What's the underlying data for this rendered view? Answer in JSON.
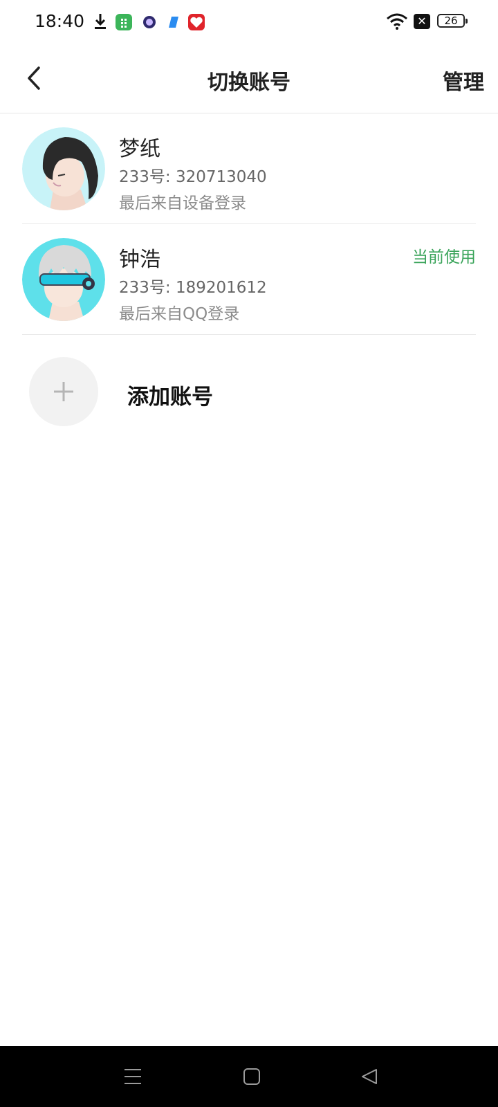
{
  "status_bar": {
    "time": "18:40",
    "battery": "26",
    "icons": [
      "download-icon",
      "app-store-icon",
      "browser-icon",
      "files-icon",
      "heart-app-icon",
      "wifi-icon",
      "no-sim-icon",
      "battery-icon"
    ]
  },
  "header": {
    "title": "切换账号",
    "manage_label": "管理",
    "back_icon": "chevron-left-icon"
  },
  "accounts": [
    {
      "name": "梦纸",
      "number": "233号: 320713040",
      "source": "最后来自设备登录",
      "current": ""
    },
    {
      "name": "钟浩",
      "number": "233号: 189201612",
      "source": "最后来自QQ登录",
      "current": "当前使用"
    }
  ],
  "add_account": {
    "label": "添加账号",
    "icon": "plus-icon"
  },
  "colors": {
    "accent_green": "#3aa45a",
    "divider": "#e9e9e9",
    "nav_background": "#000000"
  },
  "navbar": {
    "icons": [
      "menu-icon",
      "home-icon",
      "back-triangle-icon"
    ]
  }
}
